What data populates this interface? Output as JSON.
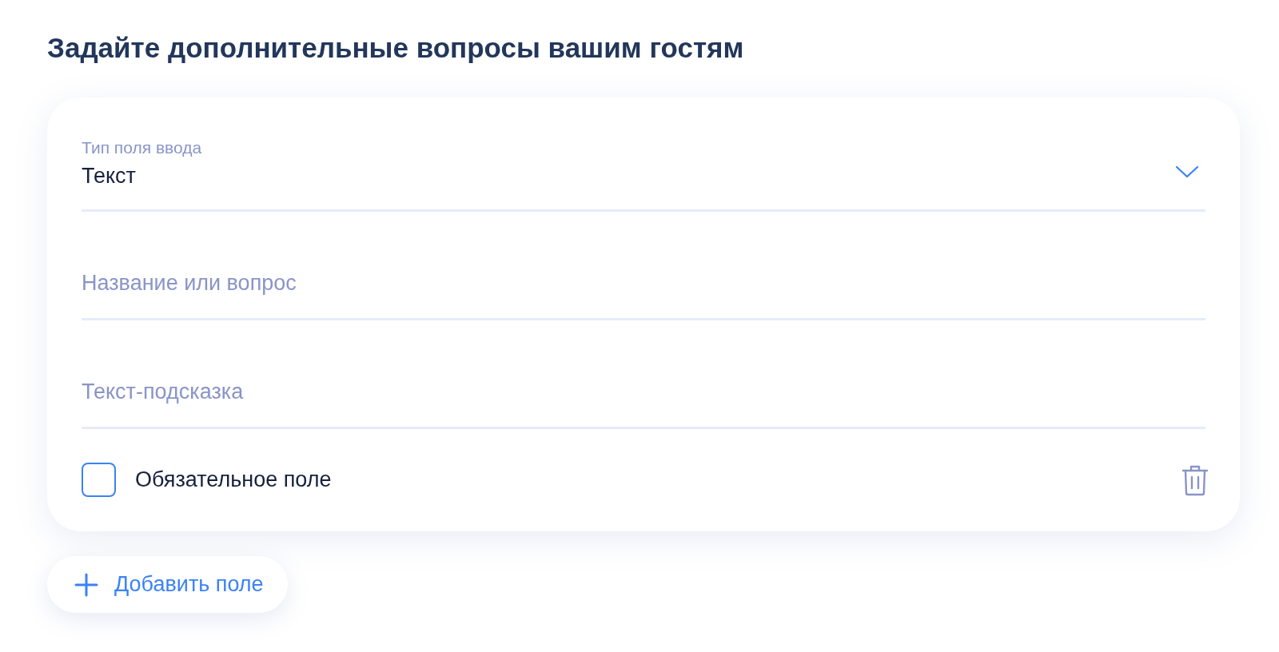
{
  "title": "Задайте дополнительные вопросы вашим гостям",
  "fields": [
    {
      "kind": "select",
      "label": "Тип поля ввода",
      "value": "Текст"
    },
    {
      "kind": "text",
      "placeholder": "Название или вопрос"
    },
    {
      "kind": "text",
      "placeholder": "Текст-подсказка"
    }
  ],
  "required": {
    "label": "Обязательное поле",
    "checked": false
  },
  "add_button": {
    "label": "Добавить поле"
  }
}
